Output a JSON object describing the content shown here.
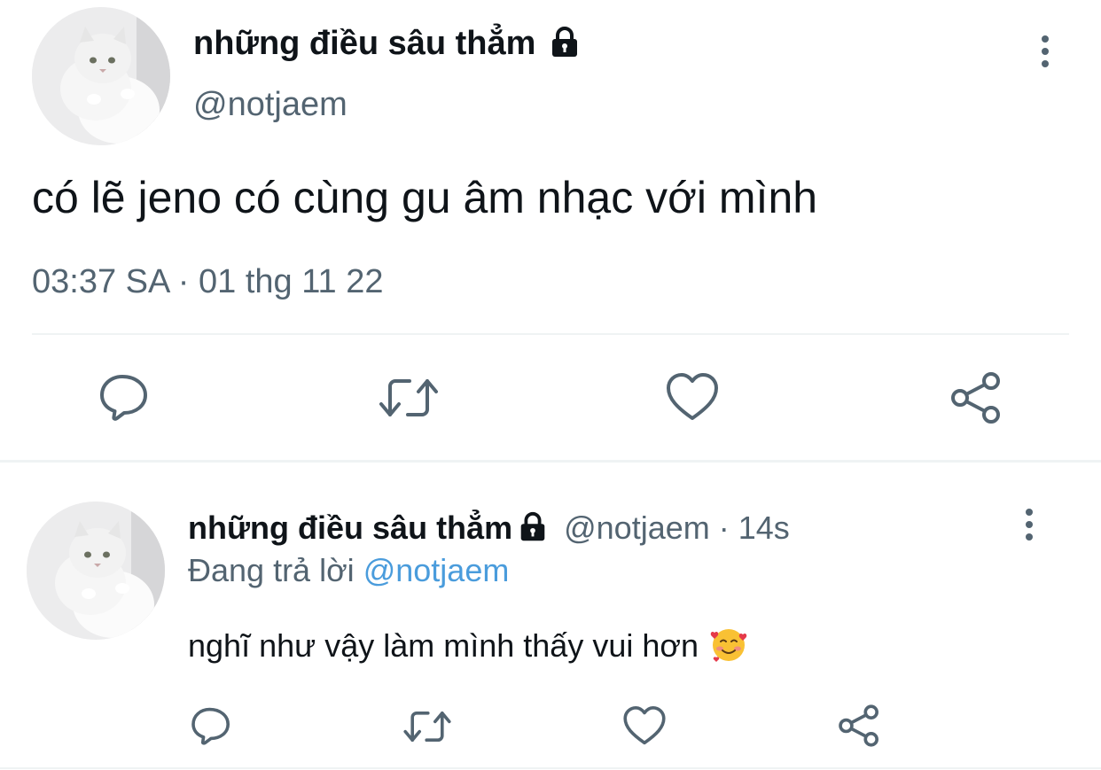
{
  "main_tweet": {
    "display_name": "những điều sâu thẳm",
    "handle": "@notjaem",
    "text": "có lẽ jeno có cùng gu âm nhạc với mình",
    "timestamp": "03:37 SA · 01 thg 11 22",
    "avatar_icon": "white-cat-photo",
    "actions": [
      "reply-icon",
      "retweet-icon",
      "like-icon",
      "share-icon"
    ]
  },
  "reply_tweet": {
    "display_name": "những điều sâu thẳm",
    "handle": "@notjaem",
    "separator": "·",
    "age": "14s",
    "replying_prefix": "Đang trả lời",
    "replying_to": "@notjaem",
    "text": "nghĩ như vậy làm mình thấy vui hơn",
    "emoji_icon": "smiling-face-with-hearts",
    "actions": [
      "reply-icon",
      "retweet-icon",
      "like-icon",
      "share-icon"
    ]
  },
  "colors": {
    "text_primary": "#0f1419",
    "text_secondary": "#536471",
    "link": "#4a9cdc",
    "divider": "#eff3f4",
    "background": "#ffffff"
  }
}
